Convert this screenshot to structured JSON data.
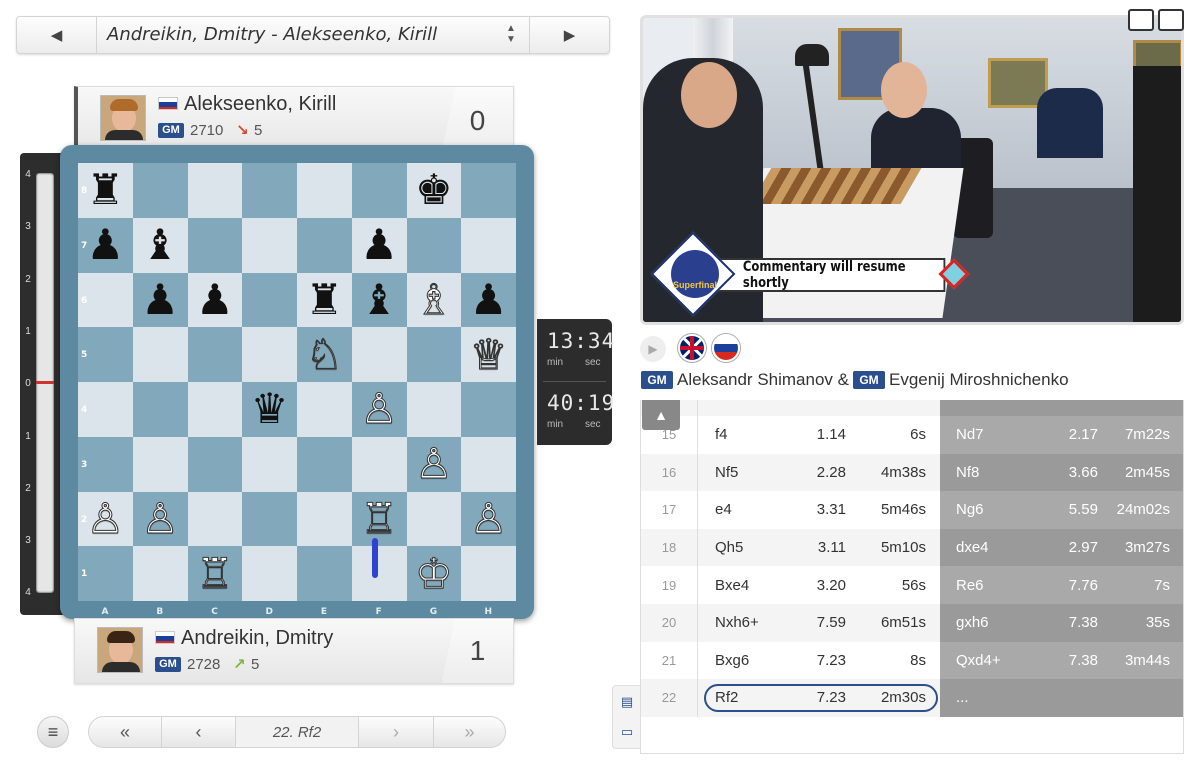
{
  "selector": {
    "title": "Andreikin, Dmitry - Alekseenko, Kirill",
    "prev_icon": "caret-left-icon",
    "next_icon": "caret-right-icon",
    "updown_icon": "sort-icon"
  },
  "top_player": {
    "name": "Alekseenko, Kirill",
    "title": "GM",
    "rating": "2710",
    "rating_change": "5",
    "rating_direction": "down",
    "score": "0",
    "flag": "Russia"
  },
  "bottom_player": {
    "name": "Andreikin, Dmitry",
    "title": "GM",
    "rating": "2728",
    "rating_change": "5",
    "rating_direction": "up",
    "score": "1",
    "flag": "Russia"
  },
  "eval_bar": {
    "ticks": [
      "4",
      "3",
      "2",
      "1",
      "0",
      "1",
      "2",
      "3",
      "4"
    ],
    "value": 0
  },
  "board": {
    "files": [
      "A",
      "B",
      "C",
      "D",
      "E",
      "F",
      "G",
      "H"
    ],
    "ranks": [
      "8",
      "7",
      "6",
      "5",
      "4",
      "3",
      "2",
      "1"
    ],
    "position": [
      [
        "bR",
        "",
        "",
        "",
        "",
        "",
        "bK",
        ""
      ],
      [
        "bP",
        "bB",
        "",
        "",
        "",
        "bP",
        "",
        ""
      ],
      [
        "",
        "bP",
        "bP",
        "",
        "bR",
        "bB",
        "wB",
        "bP"
      ],
      [
        "",
        "",
        "",
        "",
        "wN",
        "",
        "",
        "wQ"
      ],
      [
        "",
        "",
        "",
        "bQ",
        "",
        "wP",
        "",
        ""
      ],
      [
        "",
        "",
        "",
        "",
        "",
        "",
        "wP",
        ""
      ],
      [
        "wP",
        "wP",
        "",
        "",
        "",
        "wR",
        "",
        "wP"
      ],
      [
        "",
        "",
        "wR",
        "",
        "",
        "",
        "wK",
        ""
      ]
    ],
    "last_move": "Rf2"
  },
  "clocks": {
    "top": {
      "time": "13:34",
      "unit_min": "min",
      "unit_sec": "sec"
    },
    "bottom": {
      "time": "40:19",
      "unit_min": "min",
      "unit_sec": "sec"
    }
  },
  "nav": {
    "current_move": "22. Rf2",
    "first_icon": "double-chevron-left-icon",
    "prev_icon": "chevron-left-icon",
    "next_icon": "chevron-right-icon",
    "last_icon": "double-chevron-right-icon"
  },
  "video": {
    "banner_text": "Commentary will resume shortly",
    "logo_text": "Superfinal"
  },
  "commentators": {
    "title1": "GM",
    "name1": "Aleksandr Shimanov &",
    "title2": "GM",
    "name2": "Evgenij Miroshnichenko"
  },
  "moves": [
    {
      "n": "15",
      "w": "f4",
      "we": "1.14",
      "wt": "6s",
      "b": "Nd7",
      "be": "2.17",
      "bt": "7m22s"
    },
    {
      "n": "16",
      "w": "Nf5",
      "we": "2.28",
      "wt": "4m38s",
      "b": "Nf8",
      "be": "3.66",
      "bt": "2m45s"
    },
    {
      "n": "17",
      "w": "e4",
      "we": "3.31",
      "wt": "5m46s",
      "b": "Ng6",
      "be": "5.59",
      "bt": "24m02s"
    },
    {
      "n": "18",
      "w": "Qh5",
      "we": "3.11",
      "wt": "5m10s",
      "b": "dxe4",
      "be": "2.97",
      "bt": "3m27s"
    },
    {
      "n": "19",
      "w": "Bxe4",
      "we": "3.20",
      "wt": "56s",
      "b": "Re6",
      "be": "7.76",
      "bt": "7s"
    },
    {
      "n": "20",
      "w": "Nxh6+",
      "we": "7.59",
      "wt": "6m51s",
      "b": "gxh6",
      "be": "7.38",
      "bt": "35s"
    },
    {
      "n": "21",
      "w": "Bxg6",
      "we": "7.23",
      "wt": "8s",
      "b": "Qxd4+",
      "be": "7.38",
      "bt": "3m44s"
    },
    {
      "n": "22",
      "w": "Rf2",
      "we": "7.23",
      "wt": "2m30s",
      "b": "...",
      "be": "",
      "bt": ""
    }
  ],
  "colors": {
    "accent": "#2a4f8c",
    "board_light": "#dbe4ea",
    "board_dark": "#82a8bb",
    "last_move_marker": "#3043d0",
    "rating_down": "#d9462b",
    "rating_up": "#7ab83a"
  }
}
